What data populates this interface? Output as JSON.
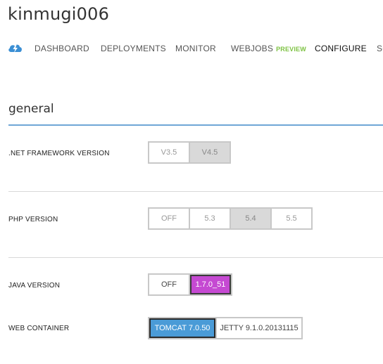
{
  "site": {
    "title": "kinmugi006"
  },
  "nav": {
    "items": [
      {
        "label": "DASHBOARD"
      },
      {
        "label": "DEPLOYMENTS"
      },
      {
        "label": "MONITOR"
      },
      {
        "label": "WEBJOBS"
      },
      {
        "label": "CONFIGURE"
      },
      {
        "label": "SC"
      }
    ],
    "preview_badge": "PREVIEW",
    "active": "CONFIGURE",
    "icon": "cloud-lightning-icon"
  },
  "section": {
    "title": "general"
  },
  "settings": {
    "net_framework": {
      "label": ".NET FRAMEWORK VERSION",
      "options": [
        "V3.5",
        "V4.5"
      ],
      "selected": "V4.5"
    },
    "php": {
      "label": "PHP VERSION",
      "options": [
        "OFF",
        "5.3",
        "5.4",
        "5.5"
      ],
      "selected": "5.4"
    },
    "java": {
      "label": "JAVA VERSION",
      "options": [
        "OFF",
        "1.7.0_51"
      ],
      "selected": "1.7.0_51"
    },
    "web_container": {
      "label": "WEB CONTAINER",
      "options": [
        "TOMCAT 7.0.50",
        "JETTY 9.1.0.20131115"
      ],
      "selected": "TOMCAT 7.0.50"
    }
  },
  "colors": {
    "accent_blue": "#4a9bd7",
    "java_selected": "#c549d2",
    "preview_green": "#7dc242",
    "rule_blue": "#6fa6d6"
  }
}
